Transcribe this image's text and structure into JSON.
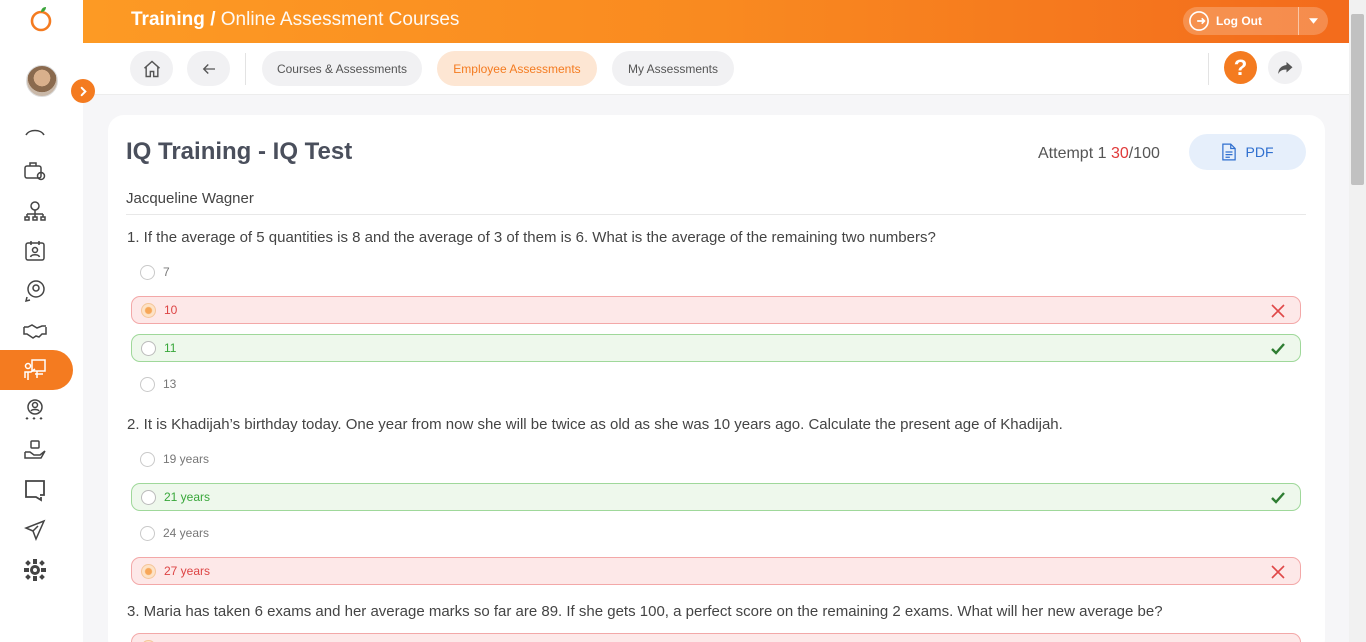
{
  "header": {
    "module": "Training",
    "separator": "/",
    "section": "Online Assessment Courses",
    "logout_label": "Log Out"
  },
  "toolbar": {
    "tabs": [
      {
        "label": "Courses & Assessments",
        "active": false
      },
      {
        "label": "Employee Assessments",
        "active": true
      },
      {
        "label": "My Assessments",
        "active": false
      }
    ],
    "help_label": "?"
  },
  "assessment": {
    "title": "IQ Training - IQ Test",
    "attempt_label": "Attempt 1",
    "score": "30",
    "total": "/100",
    "pdf_label": "PDF",
    "employee_name": "Jacqueline Wagner"
  },
  "questions": [
    {
      "text": "1. If the average of 5 quantities is 8 and the average of 3 of them is 6. What is the average of the remaining two numbers?",
      "options": [
        {
          "label": "7",
          "state": "none"
        },
        {
          "label": "10",
          "state": "wrong"
        },
        {
          "label": "11",
          "state": "correct"
        },
        {
          "label": "13",
          "state": "none"
        }
      ]
    },
    {
      "text": "2. It is Khadijah’s birthday today. One year from now she will be twice as old as she was 10 years ago. Calculate the present age of Khadijah.",
      "options": [
        {
          "label": "19 years",
          "state": "none"
        },
        {
          "label": "21 years",
          "state": "correct"
        },
        {
          "label": "24 years",
          "state": "none"
        },
        {
          "label": "27 years",
          "state": "wrong"
        }
      ]
    },
    {
      "text": "3. Maria has taken 6 exams and her average marks so far are 89. If she gets 100, a perfect score on the remaining 2 exams. What will her new average be?",
      "options": []
    }
  ],
  "colors": {
    "accent": "#f47b20",
    "wrong": "#d44444",
    "correct": "#38a73a",
    "pdf": "#2f6fcf"
  },
  "icons": {
    "sidebar": [
      "orange-logo-icon",
      "avatar",
      "chevron-right-icon",
      "partial-icon",
      "briefcase-gear-icon",
      "org-chart-icon",
      "calendar-user-icon",
      "search-user-icon",
      "handshake-icon",
      "training-presentation-icon",
      "user-stars-icon",
      "hand-bag-icon",
      "message-icon",
      "airplane-icon",
      "gear-icon"
    ]
  }
}
